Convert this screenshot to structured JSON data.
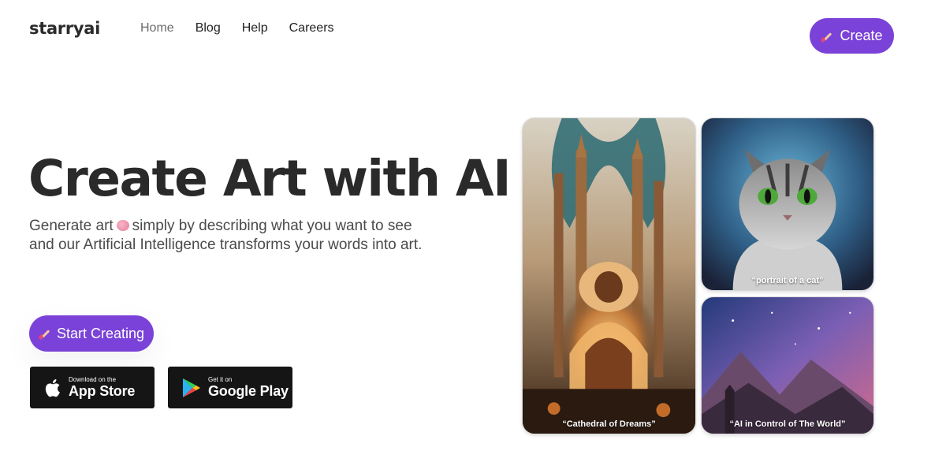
{
  "header": {
    "logo": "starryai",
    "nav": [
      {
        "label": "Home",
        "active": true
      },
      {
        "label": "Blog",
        "active": false
      },
      {
        "label": "Help",
        "active": false
      },
      {
        "label": "Careers",
        "active": false
      }
    ],
    "create_button": "Create"
  },
  "hero": {
    "title": "Create Art with AI",
    "subtitle_part1": "Generate art",
    "subtitle_part2": "simply by describing what you want to see and our Artificial Intelligence transforms your words into art.",
    "start_button": "Start Creating"
  },
  "stores": {
    "apple": {
      "small": "Download on the",
      "large": "App Store"
    },
    "google": {
      "small": "Get it on",
      "large": "Google Play"
    }
  },
  "gallery": [
    {
      "caption": "“Cathedral of Dreams”"
    },
    {
      "caption": "“portrait of a cat”"
    },
    {
      "caption": "“AI in Control of The World”"
    }
  ],
  "colors": {
    "accent": "#7a42d8",
    "badge_bg": "#151515",
    "text": "#2a2a2a"
  },
  "icons": [
    "paintbrush-icon",
    "brain-icon",
    "apple-icon",
    "google-play-icon"
  ]
}
